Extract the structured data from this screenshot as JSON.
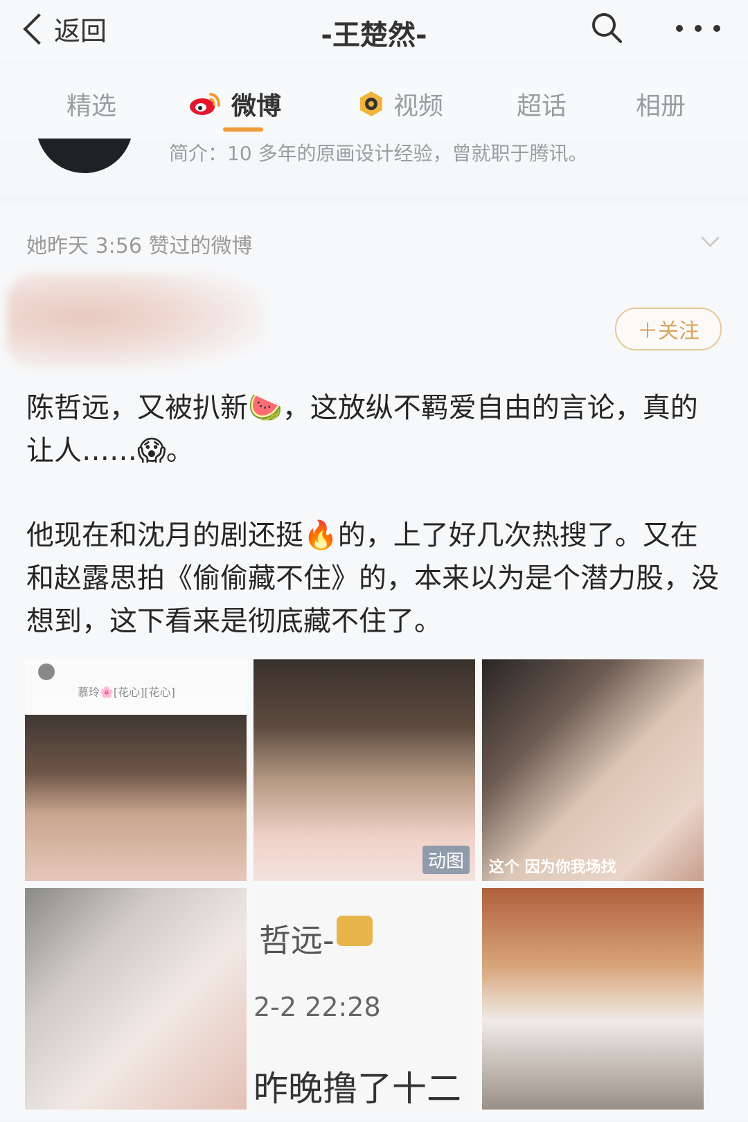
{
  "header": {
    "back_label": "返回",
    "title": "-王楚然-"
  },
  "tabs": [
    {
      "label": "精选"
    },
    {
      "label": "微博"
    },
    {
      "label": "视频"
    },
    {
      "label": "超话"
    },
    {
      "label": "相册"
    }
  ],
  "profile": {
    "bio": "简介：10 多年的原画设计经验，曾就职于腾讯。"
  },
  "feed_item": {
    "liked_label": "她昨天 3:56 赞过的微博",
    "follow_label": "＋关注",
    "post_paragraphs": [
      "陈哲远，又被扒新🍉，这放纵不羁爱自由的言论，真的让人……😱。",
      "他现在和沈月的剧还挺🔥的，上了好几次热搜了。又在和赵露思拍《偷偷藏不住》的，本来以为是个潜力股，没想到，这下看来是彻底藏不住了。"
    ],
    "images": [
      {
        "mini_text": "慕玲🌸[花心][花心]"
      },
      {
        "badge": "动图"
      },
      {
        "caption": "这个 因为你我场找"
      },
      {},
      {
        "screenshot_text1": "哲远-",
        "screenshot_text2": "2-2 22:28",
        "screenshot_text3": "昨晚撸了十二"
      },
      {}
    ]
  }
}
